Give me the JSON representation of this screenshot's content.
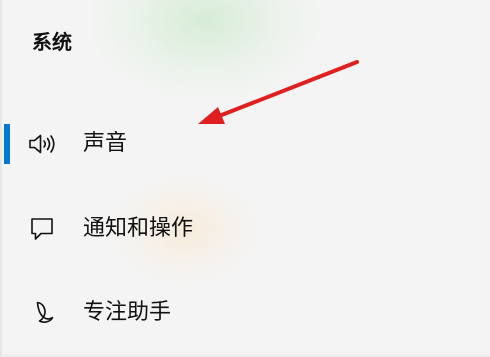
{
  "section": {
    "title": "系统"
  },
  "nav": {
    "items": [
      {
        "label": "声音",
        "icon": "speaker-icon",
        "selected": true
      },
      {
        "label": "通知和操作",
        "icon": "notification-icon",
        "selected": false
      },
      {
        "label": "专注助手",
        "icon": "moon-icon",
        "selected": false
      }
    ]
  },
  "colors": {
    "accent": "#0078d7",
    "annotation_arrow": "#e02020",
    "background": "#f4f4f4"
  }
}
